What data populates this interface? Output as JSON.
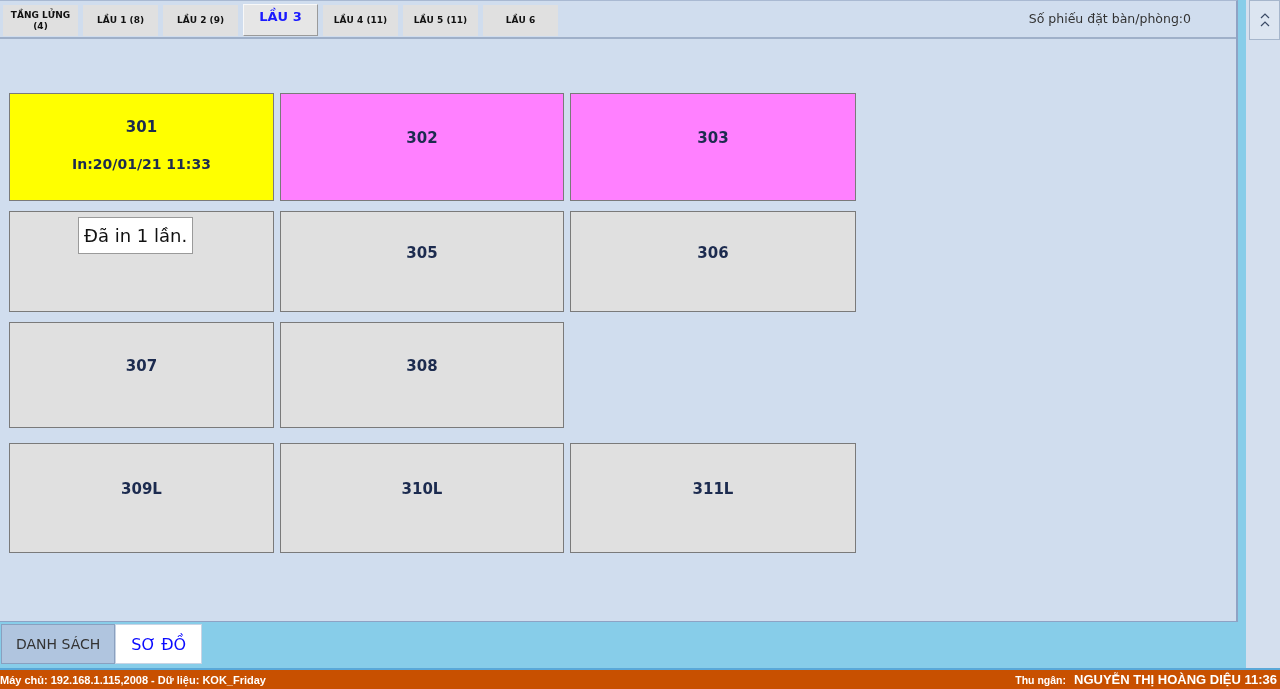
{
  "floor_tabs": [
    {
      "label": "TẦNG LỬNG (4)",
      "selected": false
    },
    {
      "label": "LẦU 1 (8)",
      "selected": false
    },
    {
      "label": "LẦU 2 (9)",
      "selected": false
    },
    {
      "label": "LẦU 3",
      "selected": true
    },
    {
      "label": "LẦU 4 (11)",
      "selected": false
    },
    {
      "label": "LẦU 5 (11)",
      "selected": false
    },
    {
      "label": "LẦU 6",
      "selected": false
    }
  ],
  "booking_count": "Số phiếu đặt bàn/phòng:0",
  "room_rows": [
    {
      "rooms": [
        {
          "label": "301",
          "note": "In:20/01/21 11:33",
          "color": "#ffff00"
        },
        {
          "label": "302",
          "color": "#ff80ff"
        },
        {
          "label": "303",
          "color": "#ff80ff"
        }
      ]
    },
    {
      "rooms": [
        {
          "color": "#e0e0e0"
        },
        {
          "label": "305",
          "color": "#e0e0e0"
        },
        {
          "label": "306",
          "color": "#e0e0e0"
        }
      ]
    },
    {
      "rooms": [
        {
          "label": "307",
          "color": "#e0e0e0"
        },
        {
          "label": "308",
          "color": "#e0e0e0"
        }
      ]
    },
    {
      "rooms": [
        {
          "label": "309L",
          "color": "#e0e0e0"
        },
        {
          "label": "310L",
          "color": "#e0e0e0"
        },
        {
          "label": "311L",
          "color": "#e0e0e0"
        }
      ]
    }
  ],
  "tooltip": "Đã in 1 lần.",
  "view_tabs": [
    {
      "label": "DANH SÁCH",
      "selected": false
    },
    {
      "label": "SƠ ĐỒ",
      "selected": true
    }
  ],
  "status_bar": {
    "server": "Máy chủ: 192.168.1.115,2008 - Dữ liệu: KOK_Friday",
    "cashier_label": "Thu ngân:",
    "cashier": "NGUYỄN THỊ HOÀNG DIỆU 11:36"
  }
}
